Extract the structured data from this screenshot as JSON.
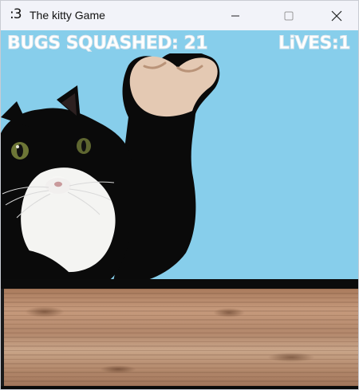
{
  "window": {
    "app_icon": ":3",
    "title": "The kitty Game",
    "controls": {
      "minimize_icon": "minimize-icon",
      "maximize_icon": "maximize-icon",
      "close_icon": "close-icon"
    }
  },
  "hud": {
    "score_label": "BUGS SQUASHED: 21",
    "lives_label": "LiVES:1"
  },
  "scene": {
    "sky_color": "#87ceeb",
    "counter_color": "#b58b6e",
    "sprite": "tuxedo-cat-icon"
  }
}
